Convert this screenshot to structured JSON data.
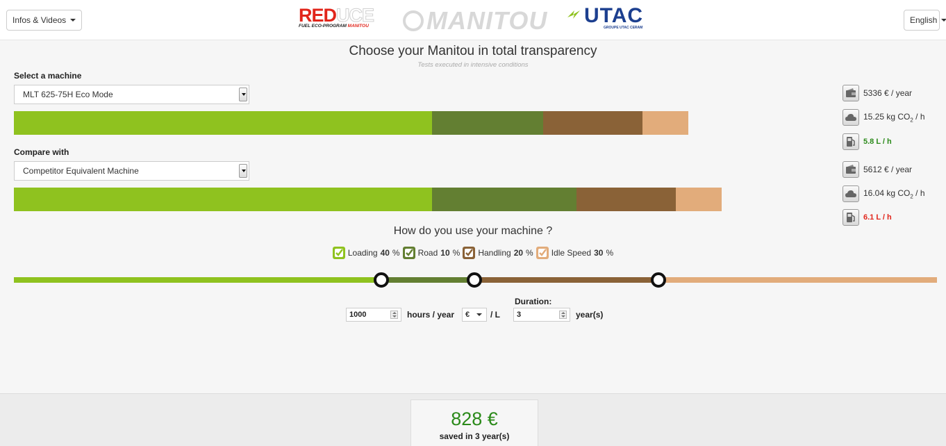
{
  "header": {
    "infos_label": "Infos & Videos",
    "language_label": "English",
    "logos": {
      "reduce_big_1": "RED",
      "reduce_big_2": "UCE",
      "reduce_small_1": "FUEL ECO-PROGRAM",
      "reduce_small_2": "MANITOU",
      "manitou": "MANITOU",
      "utac": "UTAC",
      "utac_sub": "GROUPE UTAC CERAM"
    }
  },
  "main": {
    "title": "Choose your Manitou in total transparency",
    "subtitle": "Tests executed in intensive conditions",
    "select_label": "Select a machine",
    "select_value": "MLT 625-75H Eco Mode",
    "compare_label": "Compare with",
    "compare_value": "Competitor Equivalent Machine",
    "machine_stats": {
      "cost": "5336 € / year",
      "co2_value": "15.25 kg CO",
      "co2_sub": "2",
      "co2_unit": " / h",
      "fuel": "5.8 L / h"
    },
    "compare_stats": {
      "cost": "5612 € / year",
      "co2_value": "16.04 kg CO",
      "co2_sub": "2",
      "co2_unit": " / h",
      "fuel": "6.1 L / h"
    }
  },
  "colors": {
    "loading": "#8fc21f",
    "road": "#637f32",
    "handling": "#8a6237",
    "idle": "#e2ac7b",
    "good": "#2b8a1a",
    "bad": "#e1251b"
  },
  "chart_data": {
    "type": "bar",
    "orientation": "horizontal-stacked",
    "categories": [
      "MLT 625-75H Eco Mode",
      "Competitor Equivalent Machine"
    ],
    "series": [
      {
        "name": "Loading",
        "values": [
          2.9,
          2.9
        ]
      },
      {
        "name": "Road",
        "values": [
          0.77,
          1.0
        ]
      },
      {
        "name": "Handling",
        "values": [
          0.69,
          0.69
        ]
      },
      {
        "name": "Idle Speed",
        "values": [
          0.32,
          0.32
        ]
      }
    ],
    "xlim": [
      0,
      5.7
    ]
  },
  "usage": {
    "title": "How do you use your machine ?",
    "items": [
      {
        "label": "Loading",
        "percent": "40",
        "unit": " %"
      },
      {
        "label": "Road",
        "percent": "10",
        "unit": " %"
      },
      {
        "label": "Handling",
        "percent": "20",
        "unit": " %"
      },
      {
        "label": "Idle Speed",
        "percent": "30",
        "unit": " %"
      }
    ]
  },
  "controls": {
    "hours_value": "1000",
    "hours_label": "hours / year",
    "currency_value": "€",
    "per_liter": "/ L",
    "duration_label": "Duration:",
    "duration_value": "3",
    "duration_unit": "year(s)"
  },
  "savings": {
    "amount": "828 €",
    "caption": "saved in 3 year(s)"
  }
}
